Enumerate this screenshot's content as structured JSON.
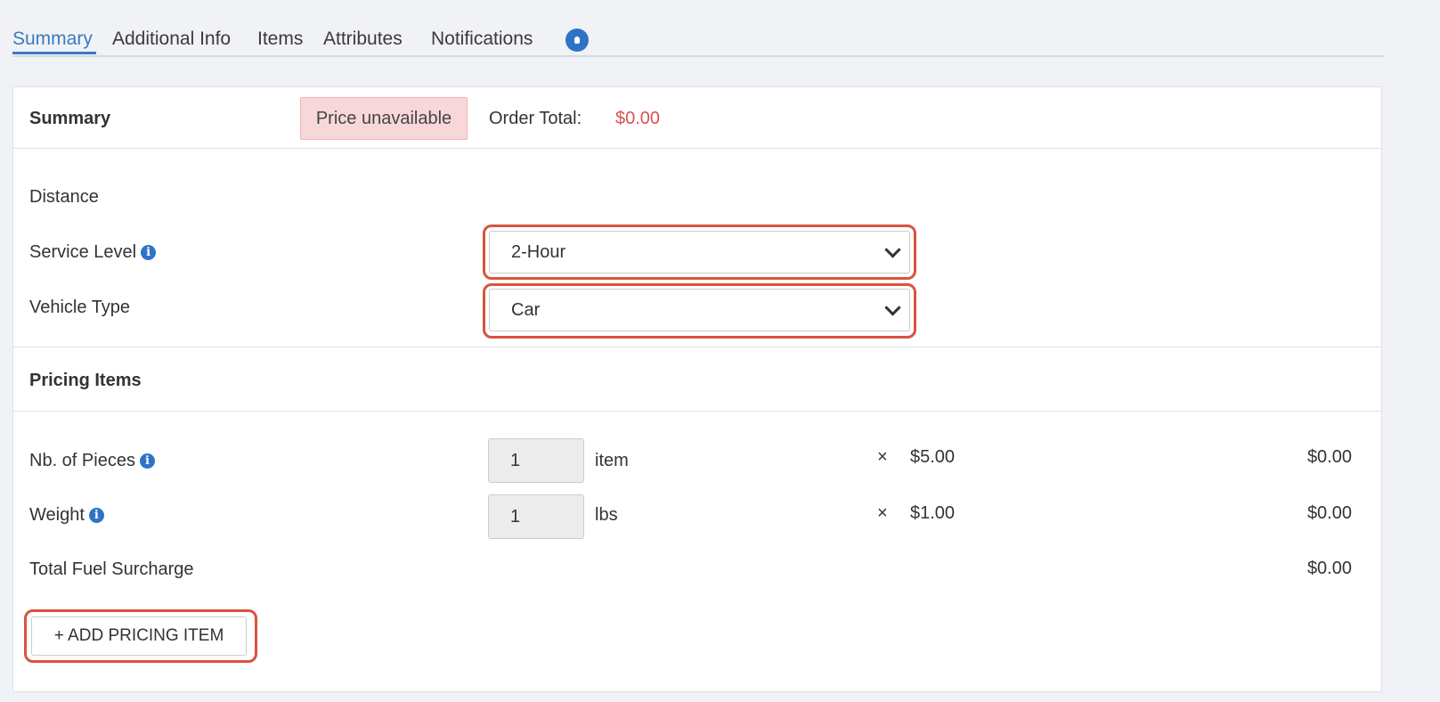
{
  "tabs": [
    {
      "label": "Summary",
      "active": true
    },
    {
      "label": "Additional Info",
      "active": false
    },
    {
      "label": "Items",
      "active": false
    },
    {
      "label": "Attributes",
      "active": false
    },
    {
      "label": "Notifications",
      "active": false
    }
  ],
  "summary": {
    "title": "Summary",
    "price_status": "Price unavailable",
    "order_total_label": "Order Total:",
    "order_total_value": "$0.00"
  },
  "fields": {
    "distance_label": "Distance",
    "service_level_label": "Service Level",
    "service_level_value": "2-Hour",
    "vehicle_type_label": "Vehicle Type",
    "vehicle_type_value": "Car"
  },
  "pricing": {
    "title": "Pricing Items",
    "rows": [
      {
        "label": "Nb. of Pieces",
        "qty": "1",
        "unit": "item",
        "times": "×",
        "rate": "$5.00",
        "total": "$0.00"
      },
      {
        "label": "Weight",
        "qty": "1",
        "unit": "lbs",
        "times": "×",
        "rate": "$1.00",
        "total": "$0.00"
      }
    ],
    "fuel_label": "Total Fuel Surcharge",
    "fuel_total": "$0.00",
    "add_button": "+ ADD PRICING ITEM"
  },
  "colors": {
    "accent": "#3a7bbf",
    "highlight": "#d9533f",
    "error_text": "#d9534f",
    "error_bg": "#f8d7da"
  },
  "icons": [
    "bell-icon",
    "info-icon",
    "chevron-down-icon"
  ]
}
